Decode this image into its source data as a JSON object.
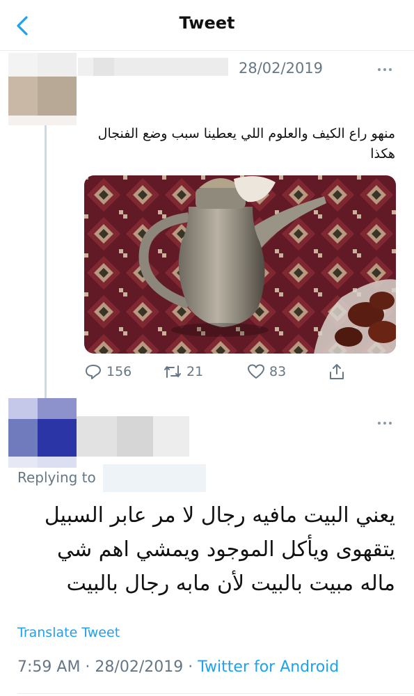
{
  "header": {
    "title": "Tweet",
    "back_icon": "chevron-left-icon"
  },
  "tweet1": {
    "date": "28/02/2019",
    "text": "منهو راع الكيف والعلوم اللي يعطينا سبب وضع الفنجال هكذا",
    "image_alt": "dallah coffee pot on patterned carpet",
    "stats": {
      "replies": "156",
      "retweets": "21",
      "likes": "83"
    }
  },
  "tweet2": {
    "replying_label": "Replying to",
    "text": "يعني البيت مافيه رجال لا مر عابر السبيل يتقهوى ويأكل الموجود ويمشي اهم شي ماله مبيت بالبيت لأن مابه رجال بالبيت",
    "translate_label": "Translate Tweet",
    "time": "7:59 AM",
    "sep1": " · ",
    "date": "28/02/2019",
    "sep2": " · ",
    "source": "Twitter for Android"
  },
  "colors": {
    "accent": "#1da1f2",
    "muted": "#657786",
    "divider": "#e6ecf0"
  }
}
